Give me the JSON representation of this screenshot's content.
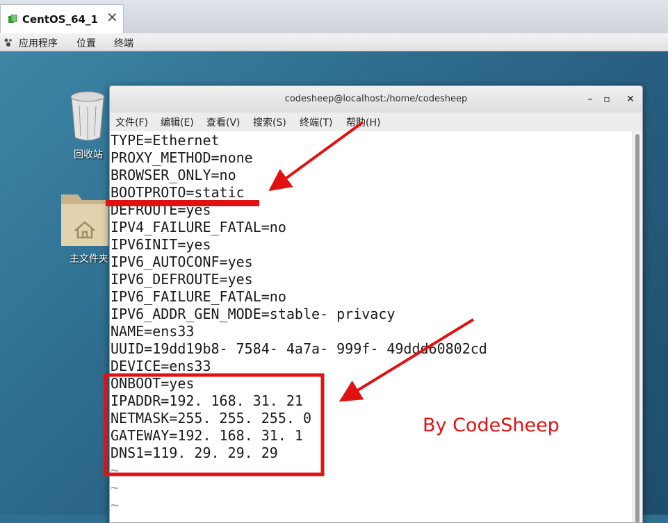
{
  "vm": {
    "tab_title": "CentOS_64_1",
    "tab_close": "✕"
  },
  "panel": {
    "applications": "应用程序",
    "places": "位置",
    "terminal": "终端"
  },
  "desktop": {
    "trash_label": "回收站",
    "home_label": "主文件夹"
  },
  "terminal": {
    "title": "codesheep@localhost:/home/codesheep",
    "controls": {
      "minimize": "–",
      "maximize": "▫",
      "close": "✕"
    },
    "menu": [
      "文件(F)",
      "编辑(E)",
      "查看(V)",
      "搜索(S)",
      "终端(T)",
      "帮助(H)"
    ],
    "lines": [
      "TYPE=Ethernet",
      "PROXY_METHOD=none",
      "BROWSER_ONLY=no",
      "BOOTPROTO=static",
      "DEFROUTE=yes",
      "IPV4_FAILURE_FATAL=no",
      "IPV6INIT=yes",
      "IPV6_AUTOCONF=yes",
      "IPV6_DEFROUTE=yes",
      "IPV6_FAILURE_FATAL=no",
      "IPV6_ADDR_GEN_MODE=stable- privacy",
      "NAME=ens33",
      "UUID=19dd19b8- 7584- 4a7a- 999f- 49ddd60802cd",
      "DEVICE=ens33",
      "ONBOOT=yes",
      "IPADDR=192. 168. 31. 21",
      "NETMASK=255. 255. 255. 0",
      "GATEWAY=192. 168. 31. 1",
      "DNS1=119. 29. 29. 29",
      "~",
      "~",
      "~"
    ]
  },
  "annotation": {
    "watermark": "By CodeSheep",
    "color": "#e21111"
  }
}
